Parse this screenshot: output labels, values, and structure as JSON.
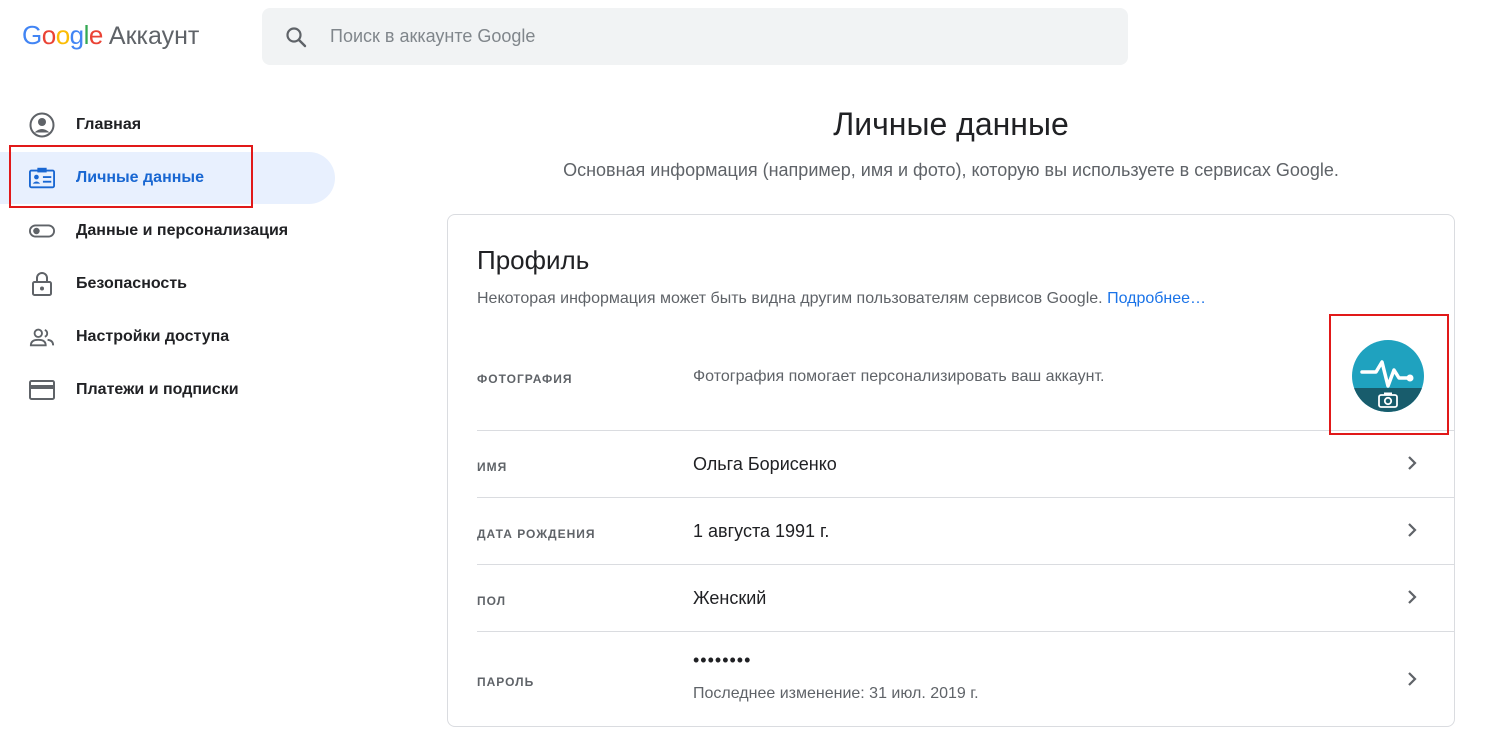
{
  "header": {
    "logo_google": "Google",
    "logo_product": "Аккаунт",
    "search_placeholder": "Поиск в аккаунте Google"
  },
  "sidebar": {
    "items": [
      {
        "label": "Главная",
        "icon": "account-circle-icon",
        "active": false
      },
      {
        "label": "Личные данные",
        "icon": "id-card-icon",
        "active": true
      },
      {
        "label": "Данные и персонализация",
        "icon": "toggle-icon",
        "active": false
      },
      {
        "label": "Безопасность",
        "icon": "lock-icon",
        "active": false
      },
      {
        "label": "Настройки доступа",
        "icon": "people-icon",
        "active": false
      },
      {
        "label": "Платежи и подписки",
        "icon": "credit-card-icon",
        "active": false
      }
    ]
  },
  "main": {
    "title": "Личные данные",
    "subtitle": "Основная информация (например, имя и фото), которую вы используете в сервисах Google."
  },
  "profile": {
    "title": "Профиль",
    "description": "Некоторая информация может быть видна другим пользователям сервисов Google.",
    "more_link": "Подробнее…",
    "rows": {
      "photo": {
        "label": "ФОТОГРАФИЯ",
        "value": "Фотография помогает персонализировать ваш аккаунт."
      },
      "name": {
        "label": "ИМЯ",
        "value": "Ольга Борисенко"
      },
      "birthday": {
        "label": "ДАТА РОЖДЕНИЯ",
        "value": "1 августа 1991 г."
      },
      "gender": {
        "label": "ПОЛ",
        "value": "Женский"
      },
      "password": {
        "label": "ПАРОЛЬ",
        "value": "••••••••",
        "note": "Последнее изменение: 31 июл. 2019 г."
      }
    }
  },
  "colors": {
    "accent": "#1a73e8",
    "active_nav_bg": "#e8f0fe",
    "active_nav_text": "#1967d2",
    "highlight_box": "#e11919",
    "avatar_bg": "#1fa2bf"
  }
}
